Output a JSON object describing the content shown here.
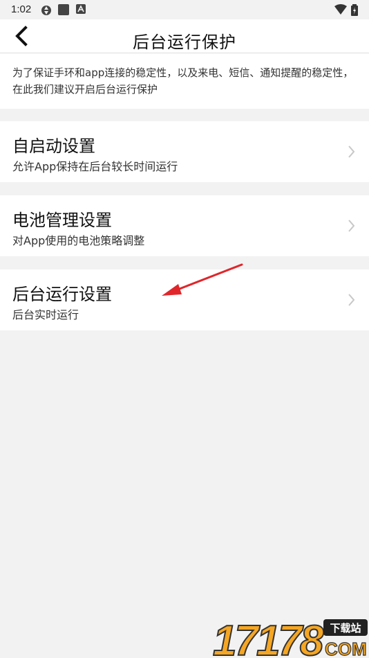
{
  "status": {
    "time": "1:02"
  },
  "header": {
    "title": "后台运行保护"
  },
  "intro": {
    "text": "为了保证手环和app连接的稳定性，以及来电、短信、通知提醒的稳定性，在此我们建议开启后台运行保护"
  },
  "settings": [
    {
      "title": "自启动设置",
      "subtitle": "允许App保持在后台较长时间运行"
    },
    {
      "title": "电池管理设置",
      "subtitle": "对App使用的电池策略调整"
    },
    {
      "title": "后台运行设置",
      "subtitle": "后台实时运行"
    }
  ],
  "watermark": {
    "number": "17178",
    "tag": "下载站",
    "domain": "COM"
  },
  "colors": {
    "annotation_arrow": "#e0262a",
    "watermark_orange": "#f5a623",
    "background": "#f2f2f2"
  }
}
